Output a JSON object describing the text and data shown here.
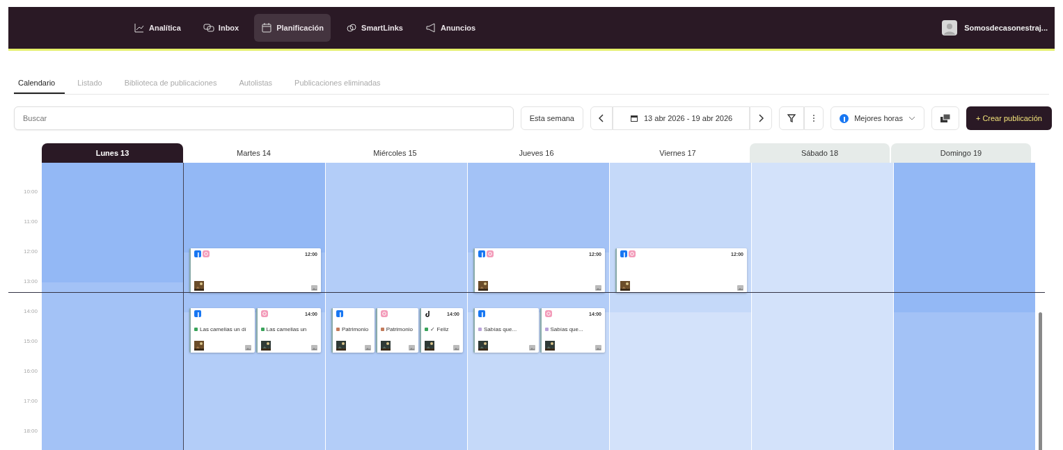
{
  "nav": {
    "items": [
      {
        "kind": "chart",
        "label": "Analítica",
        "selected": false
      },
      {
        "kind": "chat",
        "label": "Inbox",
        "selected": false
      },
      {
        "kind": "calendar",
        "label": "Planificación",
        "selected": true
      },
      {
        "kind": "link",
        "label": "SmartLinks",
        "selected": false
      },
      {
        "kind": "megaphone",
        "label": "Anuncios",
        "selected": false
      }
    ],
    "user": {
      "name": "Somosdecasonestraj..."
    }
  },
  "tabs": [
    {
      "label": "Calendario",
      "selected": true
    },
    {
      "label": "Listado",
      "selected": false
    },
    {
      "label": "Biblioteca de publicaciones",
      "selected": false
    },
    {
      "label": "Autolistas",
      "selected": false
    },
    {
      "label": "Publicaciones eliminadas",
      "selected": false
    }
  ],
  "toolbar": {
    "search": {
      "placeholder": "Buscar"
    },
    "this_week": "Esta semana",
    "date_range": "13 abr 2026 - 19 abr 2026",
    "best_hours": "Mejores horas",
    "create": "+ Crear publicación"
  },
  "times": [
    "10:00",
    "11:00",
    "12:00",
    "13:00",
    "14:00",
    "15:00",
    "16:00",
    "17:00",
    "18:00"
  ],
  "days": [
    {
      "label": "Lunes 13",
      "selected": true,
      "weekend": false,
      "slots": [
        {
          "kind": "deep"
        },
        {
          "kind": "deep"
        },
        {
          "kind": "deep"
        },
        {
          "kind": "deep"
        },
        {
          "kind": "strong"
        },
        {
          "kind": "strong"
        },
        {
          "kind": "strong"
        },
        {
          "kind": "strong"
        },
        {
          "kind": "strong"
        },
        {
          "kind": "strong"
        }
      ]
    },
    {
      "label": "Martes 14",
      "selected": false,
      "weekend": false,
      "slots": [
        {
          "kind": "deep"
        },
        {
          "kind": "deep"
        },
        {
          "kind": "deep"
        },
        {
          "kind": "strong",
          "posts": [
            {
              "networks": [
                {
                  "kind": "facebook"
                },
                {
                  "kind": "instagram"
                }
              ],
              "time": "12:00"
            }
          ]
        },
        {
          "kind": "strong"
        },
        {
          "kind": "mid",
          "posts": [
            {
              "networks": [
                {
                  "kind": "facebook"
                }
              ],
              "title": "Las camelias un dí",
              "color": "#3aa35a"
            },
            {
              "networks": [
                {
                  "kind": "instagram"
                }
              ],
              "time": "14:00",
              "title": "Las camelias un",
              "color": "#3aa35a"
            }
          ]
        },
        {
          "kind": "mid"
        },
        {
          "kind": "mid"
        },
        {
          "kind": "mid"
        },
        {
          "kind": "mid"
        }
      ]
    },
    {
      "label": "Miércoles 15",
      "selected": false,
      "weekend": false,
      "slots": [
        {
          "kind": "mid"
        },
        {
          "kind": "mid"
        },
        {
          "kind": "mid"
        },
        {
          "kind": "mid"
        },
        {
          "kind": "mid"
        },
        {
          "kind": "mid",
          "posts": [
            {
              "networks": [
                {
                  "kind": "facebook"
                }
              ],
              "title": "Patrimonio",
              "color": "#c27a5a"
            },
            {
              "networks": [
                {
                  "kind": "instagram"
                }
              ],
              "title": "Patrimonio",
              "color": "#c27a5a"
            },
            {
              "networks": [
                {
                  "kind": "tiktok"
                }
              ],
              "time": "14:00",
              "title": "✓ Feliz",
              "color": "#3aa35a"
            }
          ]
        },
        {
          "kind": "mid"
        },
        {
          "kind": "mid"
        },
        {
          "kind": "mid"
        },
        {
          "kind": "mid"
        }
      ]
    },
    {
      "label": "Jueves 16",
      "selected": false,
      "weekend": false,
      "slots": [
        {
          "kind": "strong"
        },
        {
          "kind": "strong"
        },
        {
          "kind": "strong"
        },
        {
          "kind": "mid",
          "posts": [
            {
              "networks": [
                {
                  "kind": "facebook"
                },
                {
                  "kind": "instagram"
                }
              ],
              "time": "12:00"
            }
          ]
        },
        {
          "kind": "mid"
        },
        {
          "kind": "light",
          "posts": [
            {
              "networks": [
                {
                  "kind": "facebook"
                }
              ],
              "title": "Sabías que...",
              "color": "#b9a3d9"
            },
            {
              "networks": [
                {
                  "kind": "instagram"
                }
              ],
              "time": "14:00",
              "title": "Sabías que...",
              "color": "#b9a3d9"
            }
          ]
        },
        {
          "kind": "light"
        },
        {
          "kind": "light"
        },
        {
          "kind": "light"
        },
        {
          "kind": "light"
        }
      ]
    },
    {
      "label": "Viernes 17",
      "selected": false,
      "weekend": false,
      "slots": [
        {
          "kind": "light"
        },
        {
          "kind": "light"
        },
        {
          "kind": "light"
        },
        {
          "kind": "light",
          "posts": [
            {
              "networks": [
                {
                  "kind": "facebook"
                },
                {
                  "kind": "instagram"
                }
              ],
              "time": "12:00"
            }
          ]
        },
        {
          "kind": "light"
        },
        {
          "kind": "pale"
        },
        {
          "kind": "pale"
        },
        {
          "kind": "pale"
        },
        {
          "kind": "pale"
        },
        {
          "kind": "pale"
        }
      ]
    },
    {
      "label": "Sábado 18",
      "selected": false,
      "weekend": true,
      "slots": [
        {
          "kind": "pale"
        },
        {
          "kind": "pale"
        },
        {
          "kind": "pale"
        },
        {
          "kind": "pale"
        },
        {
          "kind": "pale"
        },
        {
          "kind": "pale"
        },
        {
          "kind": "pale"
        },
        {
          "kind": "pale"
        },
        {
          "kind": "pale"
        },
        {
          "kind": "pale"
        }
      ]
    },
    {
      "label": "Domingo 19",
      "selected": false,
      "weekend": true,
      "slots": [
        {
          "kind": "deep"
        },
        {
          "kind": "deep"
        },
        {
          "kind": "deep"
        },
        {
          "kind": "deep"
        },
        {
          "kind": "deep"
        },
        {
          "kind": "strong"
        },
        {
          "kind": "strong"
        },
        {
          "kind": "strong"
        },
        {
          "kind": "strong"
        },
        {
          "kind": "strong"
        }
      ]
    }
  ]
}
